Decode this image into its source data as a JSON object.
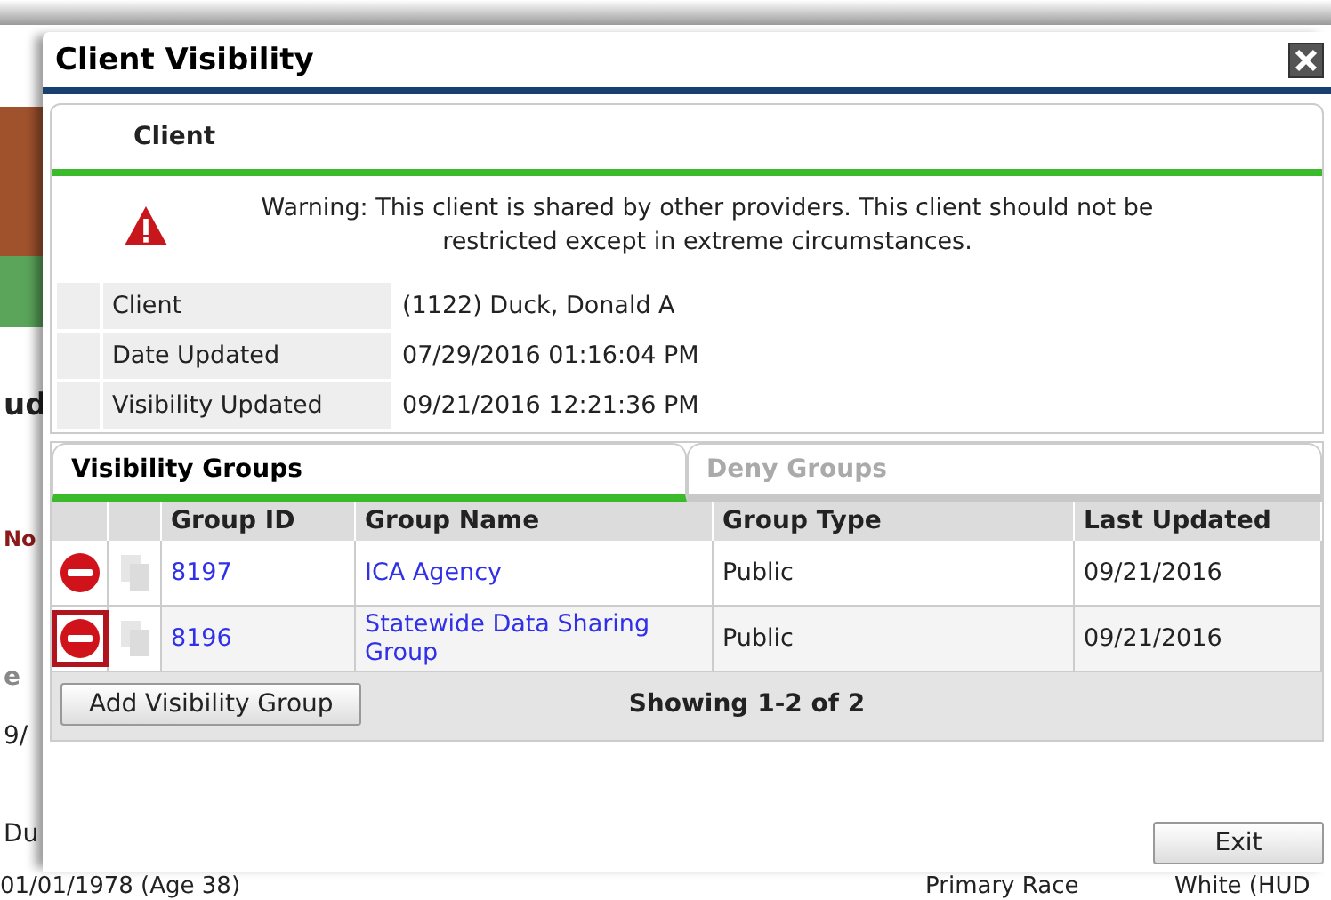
{
  "background": {
    "left_texts": [
      {
        "text": "ud",
        "kind": "heading"
      },
      {
        "text": "No",
        "kind": "alert"
      },
      {
        "text": "e",
        "kind": "muted"
      },
      {
        "text": "9/",
        "kind": "plain"
      },
      {
        "text": "Du",
        "kind": "plain"
      }
    ],
    "bottom_row": [
      "01/01/1978 (Age 38)",
      "Primary Race",
      "White (HUD"
    ]
  },
  "dialog": {
    "title": "Client Visibility",
    "section_title": "Client",
    "warning": "Warning: This client is shared by other providers. This client should not be restricted except in extreme circumstances.",
    "details": [
      {
        "label": "Client",
        "value": "(1122) Duck, Donald A"
      },
      {
        "label": "Date Updated",
        "value": "07/29/2016 01:16:04 PM"
      },
      {
        "label": "Visibility Updated",
        "value": "09/21/2016 12:21:36 PM"
      }
    ],
    "tabs": [
      {
        "label": "Visibility Groups",
        "selected": true
      },
      {
        "label": "Deny Groups",
        "selected": false
      }
    ],
    "table": {
      "columns": [
        "Group ID",
        "Group Name",
        "Group Type",
        "Last Updated"
      ],
      "rows": [
        {
          "group_id": "8197",
          "group_name": "ICA Agency",
          "group_type": "Public",
          "last_updated": "09/21/2016",
          "highlighted": false
        },
        {
          "group_id": "8196",
          "group_name": "Statewide Data Sharing Group",
          "group_type": "Public",
          "last_updated": "09/21/2016",
          "highlighted": true
        }
      ]
    },
    "add_button": "Add Visibility Group",
    "pager": "Showing 1-2 of 2",
    "exit_button": "Exit"
  }
}
